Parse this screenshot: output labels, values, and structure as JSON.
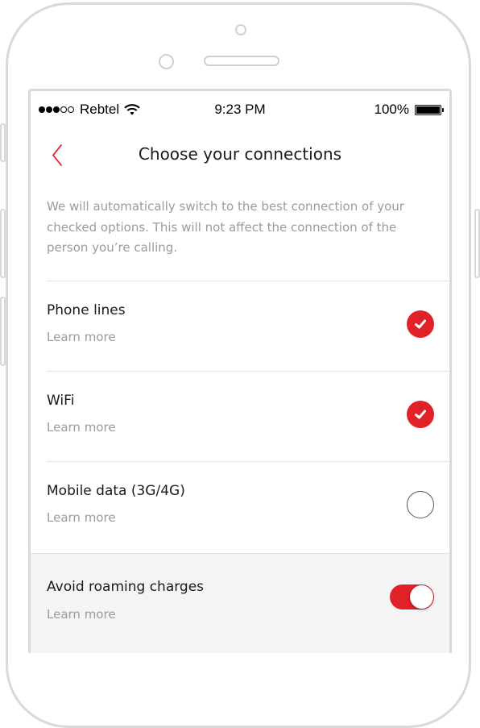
{
  "statusbar": {
    "carrier": "Rebtel",
    "time": "9:23 PM",
    "battery": "100%",
    "signal_dots_filled": 3,
    "signal_dots_total": 5
  },
  "nav": {
    "back_icon": "chevron-left-icon",
    "title": "Choose your connections"
  },
  "description": "We will automatically switch to the best connection of your checked options. This will not affect the connection of the person you’re calling.",
  "options": [
    {
      "title": "Phone lines",
      "link": "Learn more",
      "checked": true
    },
    {
      "title": "WiFi",
      "link": "Learn more",
      "checked": true
    },
    {
      "title": "Mobile data (3G/4G)",
      "link": "Learn more",
      "checked": false
    }
  ],
  "roaming": {
    "title": "Avoid roaming charges",
    "link": "Learn more",
    "enabled": true
  },
  "colors": {
    "accent": "#e02127",
    "text_primary": "#1a1a1a",
    "text_secondary": "#9b9b9b",
    "divider": "#e4e4e4",
    "shaded_bg": "#f4f4f4",
    "device_frame": "#d9d9d9"
  }
}
